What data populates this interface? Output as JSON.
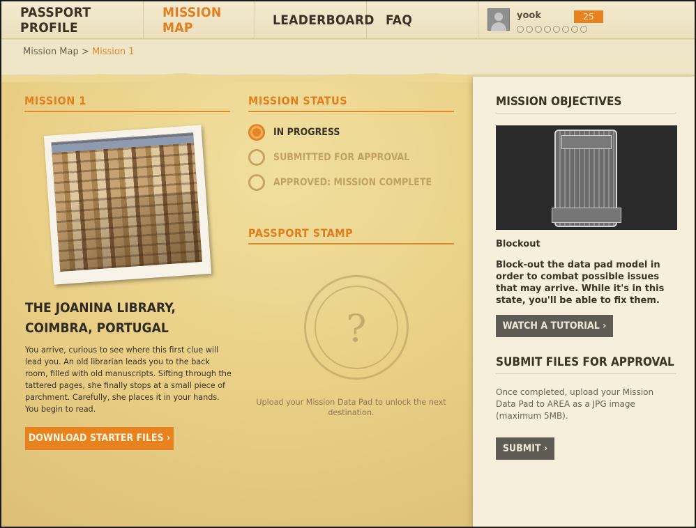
{
  "nav": {
    "items": [
      {
        "label": "Passport Profile",
        "active": false
      },
      {
        "label": "Mission Map",
        "active": true
      },
      {
        "label": "Leaderboard",
        "active": false
      },
      {
        "label": "FAQ",
        "active": false
      }
    ],
    "user": {
      "name": "yook",
      "points": "25",
      "progress_dots_total": 8,
      "progress_dots_filled": 0
    }
  },
  "breadcrumb": {
    "parent": "Mission Map",
    "separator": ">",
    "current": "Mission 1"
  },
  "mission": {
    "heading": "Mission 1",
    "place_line1": "The Joanina Library,",
    "place_line2": "Coimbra, Portugal",
    "story": "You arrive, curious to see where this first clue will lead you. An old librarian leads you to the back room, filled with old manuscripts. Sifting through the tattered pages, she finally stops at a small piece of parchment. Carefully, she places it in your hands. You begin to read.",
    "download_button": "Download Starter Files"
  },
  "status": {
    "heading": "Mission Status",
    "options": [
      {
        "label": "In Progress",
        "selected": true
      },
      {
        "label": "Submitted for Approval",
        "selected": false
      },
      {
        "label": "Approved: Mission Complete",
        "selected": false
      }
    ]
  },
  "stamp": {
    "heading": "Passport Stamp",
    "symbol": "?",
    "caption": "Upload your Mission Data Pad to unlock the next destination."
  },
  "objectives": {
    "heading": "Mission Objectives",
    "image_caption": "Blockout",
    "description": "Block-out the data pad model in order to combat possible issues that may arrive. While it's in this state, you'll be able to fix them.",
    "tutorial_button": "Watch a Tutorial"
  },
  "submit": {
    "heading": "Submit Files for Approval",
    "instructions": "Once completed, upload your Mission Data Pad to AREA as a JPG image (maximum 5MB).",
    "button": "Submit"
  },
  "colors": {
    "accent": "#e8821e",
    "dark_button": "#5e5a54",
    "panel_bg": "#f6efdc"
  }
}
